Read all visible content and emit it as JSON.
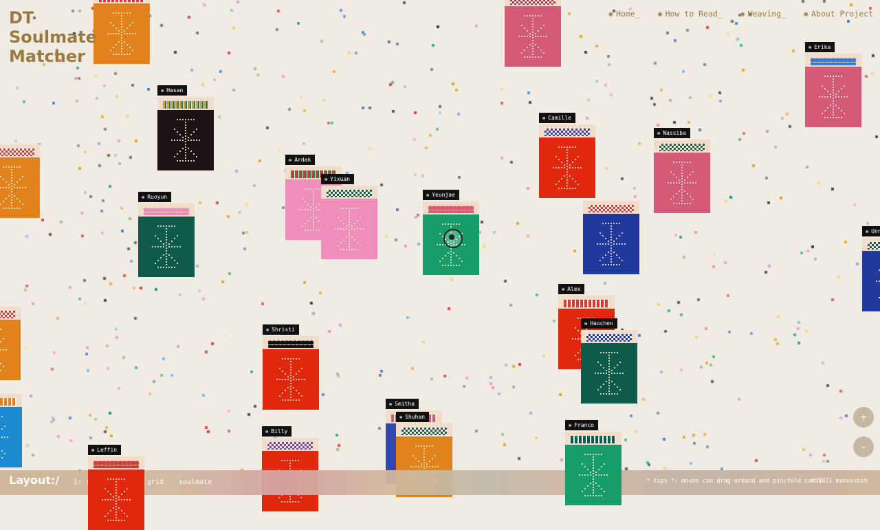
{
  "app": {
    "title_lines": [
      "DT",
      "Soulmate",
      "Matcher"
    ]
  },
  "nav": [
    {
      "label": "Home_"
    },
    {
      "label": "How to Read_"
    },
    {
      "label": "Weaving_"
    },
    {
      "label": "About Project"
    }
  ],
  "nav_star": "✱",
  "cards": [
    {
      "name": "",
      "color": "#e1821c",
      "pattern": "stripe",
      "pcolor": "#d43b34"
    },
    {
      "name": "",
      "color": "#d45a77",
      "pattern": "check",
      "pcolor": "#b03040"
    },
    {
      "name": "Erika",
      "color": "#d45a77",
      "pattern": "wave",
      "pcolor": "#3a7bd5"
    },
    {
      "name": "Hasan",
      "color": "#1b1314",
      "pattern": "bars",
      "pcolor": "#c9a227"
    },
    {
      "name": "",
      "color": "#e1821c",
      "pattern": "check",
      "pcolor": "#d43b34"
    },
    {
      "name": "Ardak",
      "color": "#f08cba",
      "pattern": "bars",
      "pcolor": "#d43b34"
    },
    {
      "name": "Yixuan",
      "color": "#f08cba",
      "pattern": "check",
      "pcolor": "#1f5b45"
    },
    {
      "name": "Ruoyun",
      "color": "#0f5b4b",
      "pattern": "wave",
      "pcolor": "#f08cba"
    },
    {
      "name": "Yeunjae",
      "color": "#179c6a",
      "pattern": "wave",
      "pcolor": "#e05870"
    },
    {
      "name": "Camille",
      "color": "#e2270f",
      "pattern": "check",
      "pcolor": "#3b3a9b"
    },
    {
      "name": "Nassiba",
      "color": "#d45a77",
      "pattern": "check",
      "pcolor": "#1f5b45"
    },
    {
      "name": "",
      "color": "#1f3a9c",
      "pattern": "check",
      "pcolor": "#d43b34"
    },
    {
      "name": "Unna",
      "color": "#1f3a9c",
      "pattern": "check",
      "pcolor": "#1f5b45"
    },
    {
      "name": "",
      "color": "#e1821c",
      "pattern": "check",
      "pcolor": "#d43b34"
    },
    {
      "name": "",
      "color": "#1c8ad1",
      "pattern": "stripe",
      "pcolor": "#e1821c"
    },
    {
      "name": "Alex",
      "color": "#e2270f",
      "pattern": "stripe",
      "pcolor": "#d43b34"
    },
    {
      "name": "Haochen",
      "color": "#0f5b4b",
      "pattern": "check",
      "pcolor": "#1f3a9c"
    },
    {
      "name": "Shristi",
      "color": "#e2270f",
      "pattern": "wave",
      "pcolor": "#111111"
    },
    {
      "name": "Smitha",
      "color": "#2f47b0",
      "pattern": "stripe",
      "pcolor": "#d45a77"
    },
    {
      "name": "Shuhan",
      "color": "#e1821c",
      "pattern": "check",
      "pcolor": "#1f5b45"
    },
    {
      "name": "Billy",
      "color": "#e2270f",
      "pattern": "check",
      "pcolor": "#7b3fa0"
    },
    {
      "name": "Leffin",
      "color": "#e2270f",
      "pattern": "wave",
      "pcolor": "#d43b34"
    },
    {
      "name": "Franco",
      "color": "#179c6a",
      "pattern": "stripe",
      "pcolor": "#0f5b4b"
    }
  ],
  "zoom": {
    "in": "+",
    "out": "-"
  },
  "bottom": {
    "layout_label": "Layout:/",
    "options": [
      "[: similarity :]",
      "grid",
      "soulmate"
    ],
    "tips": "* tips *: mouse can drag around and pin/fold cards",
    "copyright": "© 2021 munusshih"
  },
  "colors": {
    "background": "#f1ece3",
    "title": "#9a7b3f"
  }
}
